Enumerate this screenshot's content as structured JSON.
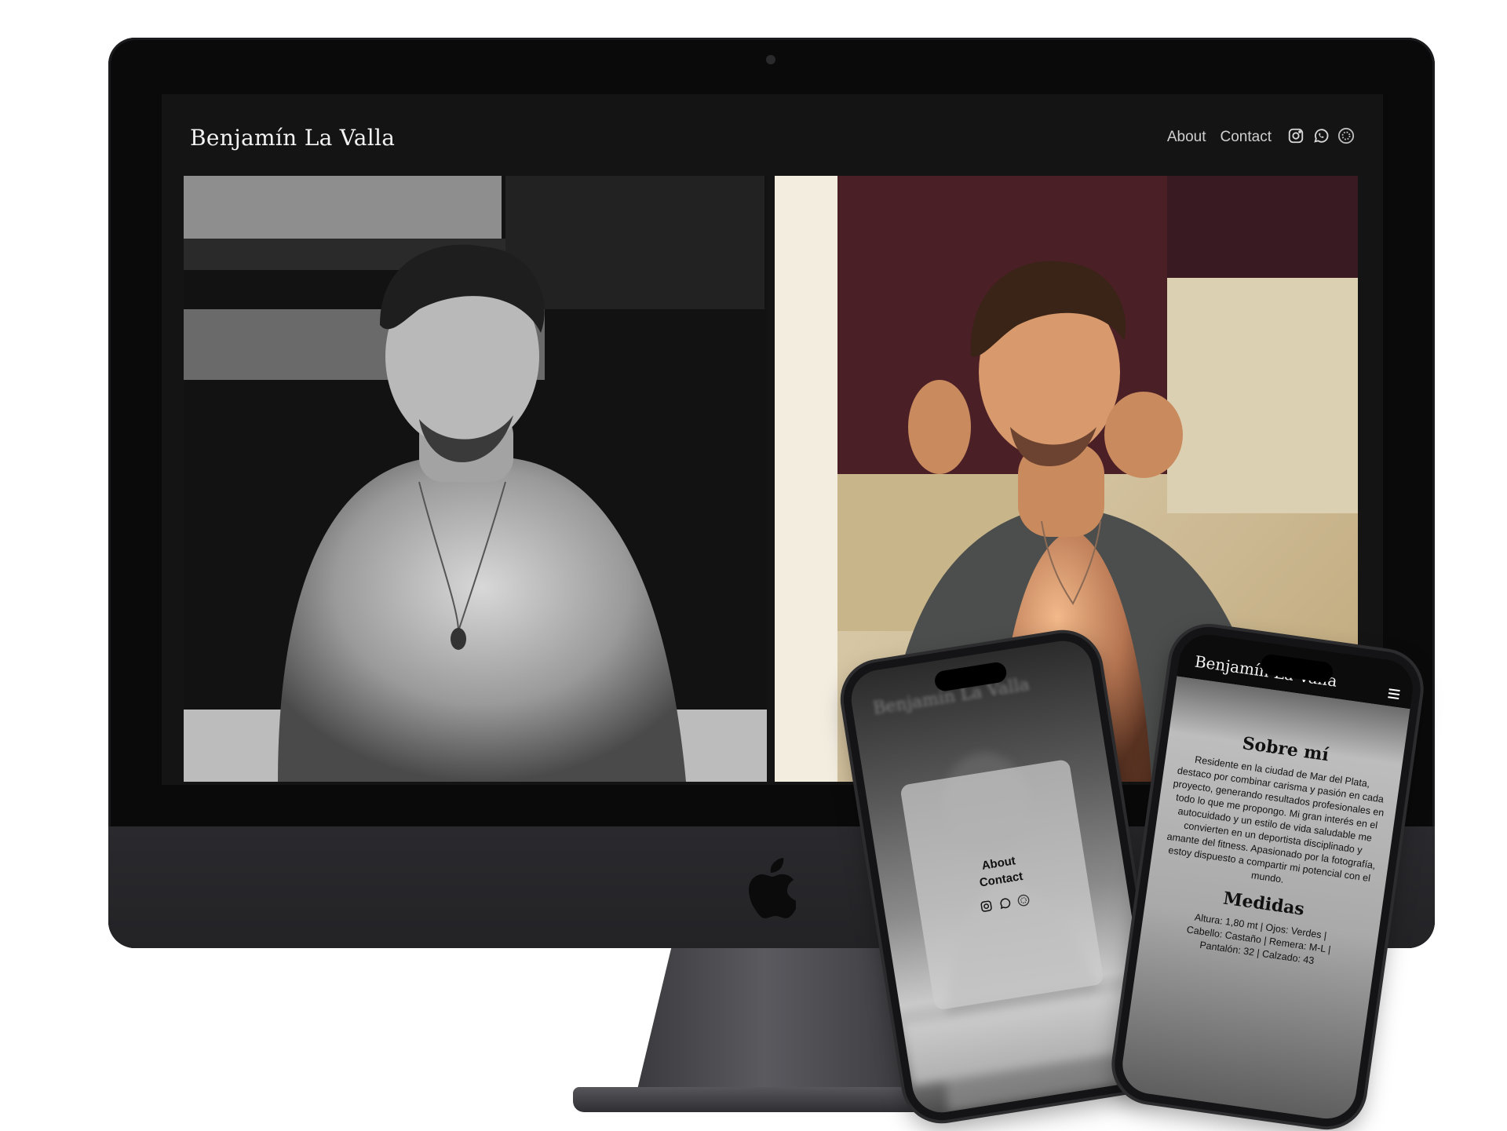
{
  "desktop": {
    "site_title": "Benjamín La Valla",
    "nav": {
      "about": "About",
      "contact": "Contact"
    },
    "social_icons": [
      "instagram-icon",
      "whatsapp-icon",
      "circle-icon"
    ]
  },
  "phone_menu": {
    "site_title": "Benjamín La Valla",
    "about": "About",
    "contact": "Contact"
  },
  "phone_about": {
    "site_title": "Benjamín La Valla",
    "about_heading": "Sobre mí",
    "about_text": "Residente en la ciudad de Mar del Plata, destaco por combinar carisma y pasión en cada proyecto, generando resultados profesionales en todo lo que me propongo. Mi gran interés en el autocuidado y un estilo de vida saludable me convierten en un deportista disciplinado y amante del fitness. Apasionado por la fotografía, estoy dispuesto a compartir mi potencial con el mundo.",
    "measures_heading": "Medidas",
    "measures_1": "Altura: 1,80 mt | Ojos: Verdes |",
    "measures_2": "Cabello: Castaño | Remera: M-L |",
    "measures_3": "Pantalón: 32 | Calzado: 43"
  },
  "colors": {
    "site_bg": "#141414",
    "text_light": "#f2f2f2",
    "nav_text": "#cfcfcf"
  }
}
